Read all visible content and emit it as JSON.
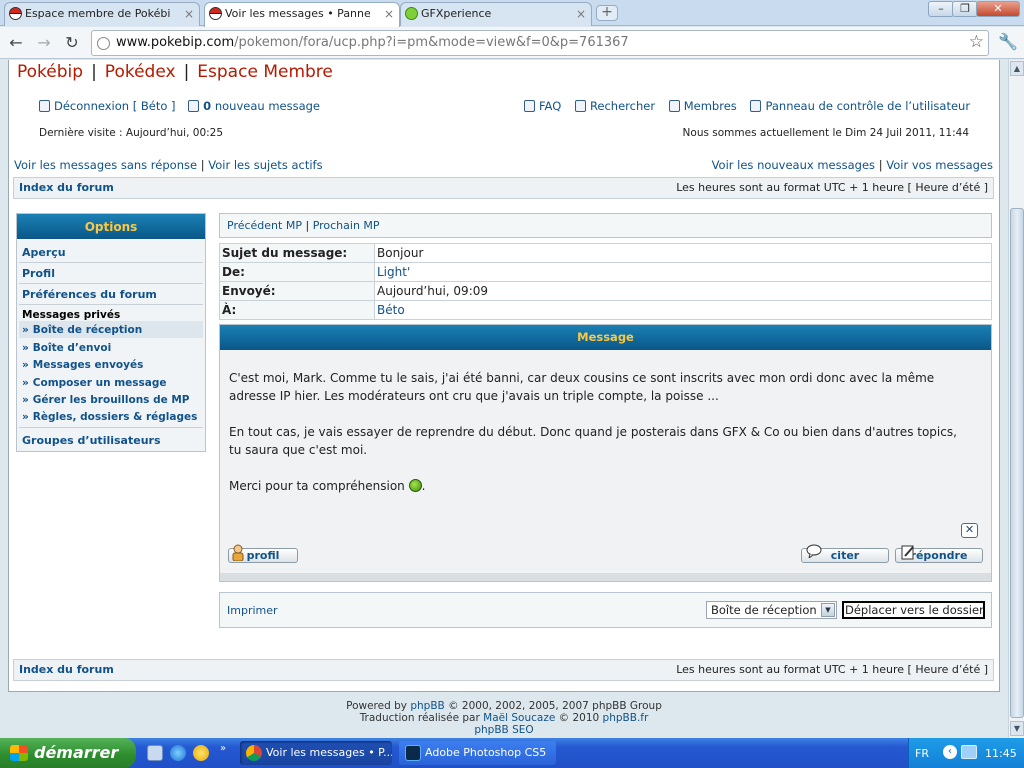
{
  "browser": {
    "tabs": [
      {
        "label": "Espace membre de Pokébip, p",
        "active": false,
        "favicon": "pokeball-icon"
      },
      {
        "label": "Voir les messages • Panneau c",
        "active": true,
        "favicon": "pokeball-icon"
      },
      {
        "label": "GFXperience",
        "active": false,
        "favicon": "gfx-icon"
      }
    ],
    "new_tab": "+",
    "url_host": "www.pokebip.com",
    "url_path": "/pokemon/fora/ucp.php?i=pm&mode=view&f=0&p=761367"
  },
  "site": {
    "brand": [
      "Pokébip",
      "Pokédex",
      "Espace Membre"
    ],
    "separator": "|"
  },
  "topnav": {
    "logout": "Déconnexion [ Béto ]",
    "new_messages_count": "0",
    "new_messages_label": "nouveau message",
    "faq": "FAQ",
    "search": "Rechercher",
    "members": "Membres",
    "ucp": "Panneau de contrôle de l’utilisateur",
    "last_visit": "Dernière visite : Aujourd’hui, 00:25",
    "current_time": "Nous sommes actuellement le Dim 24 Juil 2011, 11:44",
    "unanswered": "Voir les messages sans réponse",
    "active_topics": "Voir les sujets actifs",
    "new_posts": "Voir les nouveaux messages",
    "your_posts": "Voir vos messages",
    "sep": "|"
  },
  "breadcrumb": {
    "index": "Index du forum",
    "timezone": "Les heures sont au format UTC + 1 heure [ Heure d’été ]"
  },
  "menu": {
    "title": "Options",
    "items": [
      "Aperçu",
      "Profil",
      "Préférences du forum"
    ],
    "pm_header": "Messages privés",
    "pm_items": [
      "Boîte de réception",
      "Boîte d’envoi",
      "Messages envoyés",
      "Composer un message",
      "Gérer les brouillons de MP",
      "Règles, dossiers & réglages"
    ],
    "groups": "Groupes d’utilisateurs"
  },
  "pm": {
    "prev": "Précédent MP",
    "next": "Prochain MP",
    "sep": "|",
    "fields": {
      "subject_label": "Sujet du message:",
      "subject": "Bonjour",
      "from_label": "De:",
      "from": "Light'",
      "sent_label": "Envoyé:",
      "sent": "Aujourd’hui, 09:09",
      "to_label": "À:",
      "to": "Béto"
    },
    "message_title": "Message",
    "body": [
      "C'est moi, Mark. Comme tu le sais, j'ai été banni, car deux cousins ce sont inscrits avec mon ordi donc avec la même adresse IP hier. Les modérateurs ont cru que j'avais un triple compte, la poisse ...",
      "En tout cas, je vais essayer de reprendre du début. Donc quand je posterais dans GFX & Co ou bien dans d'autres topics, tu saura que c'est moi.",
      "Merci pour ta compréhension"
    ],
    "body_end": ".",
    "report": "✕",
    "profile_btn": "profil",
    "quote_btn": "citer",
    "reply_btn": "répondre",
    "print": "Imprimer",
    "folder_selected": "Boîte de réception",
    "move_btn": "Déplacer vers le dossier"
  },
  "footer": {
    "line1_pre": "Powered by ",
    "line1_link": "phpBB",
    "line1_post": " © 2000, 2002, 2005, 2007 phpBB Group",
    "line2_pre": "Traduction réalisée par ",
    "line2_link": "Maël Soucaze",
    "line2_mid": " © 2010 ",
    "line2_link2": "phpBB.fr",
    "line3": "phpBB SEO"
  },
  "taskbar": {
    "start": "démarrer",
    "windows": [
      "Voir les messages • P...",
      "Adobe Photoshop CS5"
    ],
    "lang": "FR",
    "clock": "11:45"
  },
  "colors": {
    "link": "#105289",
    "brand_red": "#b51a00",
    "header_blue": "#0a5788",
    "header_text": "#ffc73d"
  }
}
